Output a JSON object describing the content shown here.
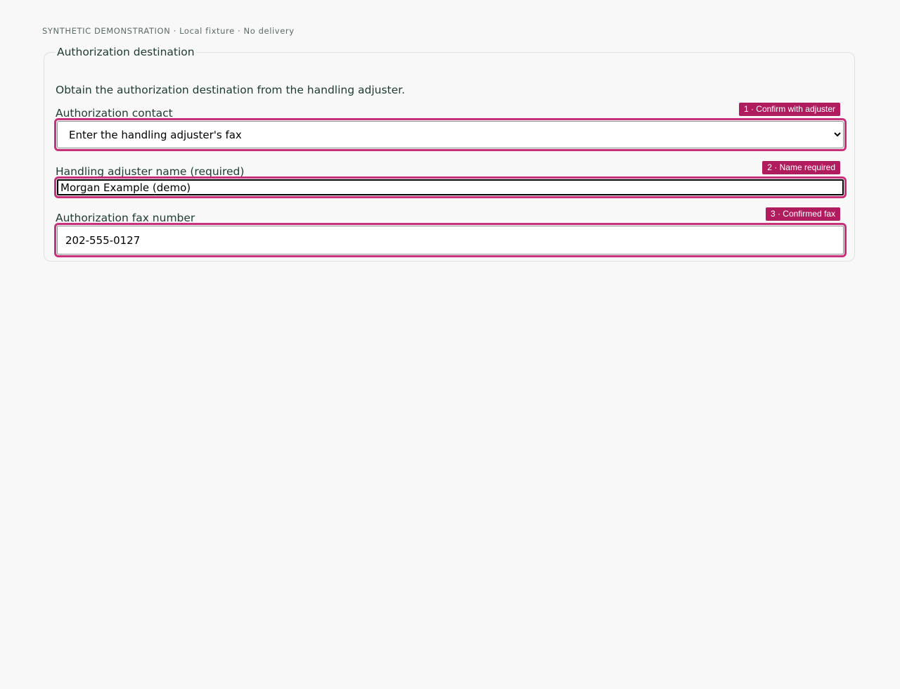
{
  "banner": "SYNTHETIC DEMONSTRATION · Local fixture · No delivery",
  "form": {
    "legend": "Authorization destination",
    "intro": "Obtain the authorization destination from the handling adjuster.",
    "contact": {
      "label": "Authorization contact",
      "badge": "1 · Confirm with adjuster",
      "selected": "Enter the handling adjuster's fax"
    },
    "adjuster": {
      "label": "Handling adjuster name (required)",
      "badge": "2 · Name required",
      "value": "Morgan Example (demo)"
    },
    "fax": {
      "label": "Authorization fax number",
      "badge": "3 · Confirmed fax",
      "value": "202-555-0127"
    }
  },
  "colors": {
    "badge_bg": "#b01d5f",
    "highlight_ring": "#c9307a",
    "page_bg": "#f7f8f7",
    "text": "#1f3a33"
  }
}
